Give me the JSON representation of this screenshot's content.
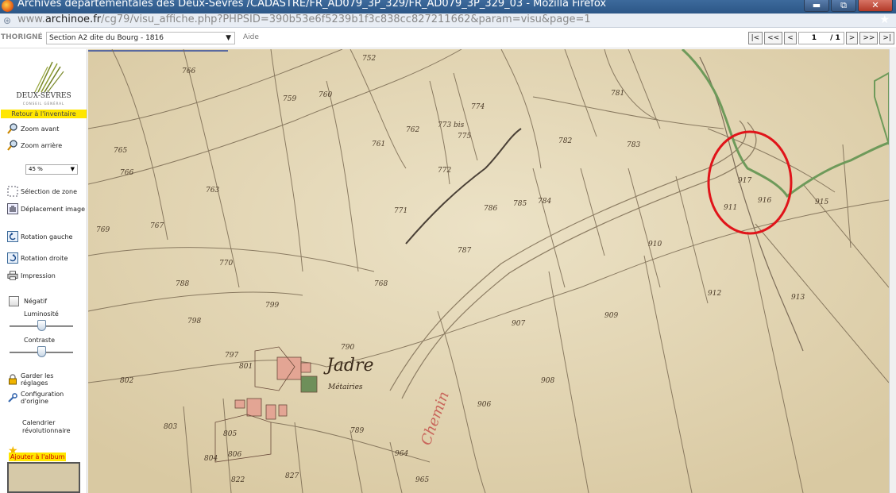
{
  "window": {
    "title": "Archives départementales des Deux-Sèvres /CADASTRE/FR_AD079_3P_329/FR_AD079_3P_329_03 - Mozilla Firefox",
    "buttons": [
      "▬",
      "⧉",
      "✕"
    ]
  },
  "address_bar": {
    "url_prefix": "www.",
    "url_domain": "archinoe.fr",
    "url_path": "/cg79/visu_affiche.php?PHPSID=390b53e6f5239b1f3c838cc827211662&param=visu&page=1"
  },
  "toolbar": {
    "commune": "THORIGNÉ",
    "section": "Section A2 dite du Bourg - 1816",
    "aide": "Aide",
    "pager": {
      "first": "|<",
      "prev_fast": "<<",
      "prev": "<",
      "current_page": "1",
      "total_pages": "/ 1",
      "next": ">",
      "next_fast": ">>",
      "last": ">|"
    }
  },
  "sidebar": {
    "logo_text": "DEUX-SÈVRES",
    "logo_sub": "CONSEIL GÉNÉRAL",
    "retour": "Retour à l'inventaire",
    "zoom_in": "Zoom avant",
    "zoom_out": "Zoom arrière",
    "zoom_level": "45 %",
    "selection_zone": "Sélection de zone",
    "deplacement": "Déplacement image",
    "rotation_gauche": "Rotation gauche",
    "rotation_droite": "Rotation droite",
    "impression": "Impression",
    "negatif": "Négatif",
    "luminosite": "Luminosité",
    "luminosite_level": 0.5,
    "contraste": "Contraste",
    "contraste_level": 0.5,
    "garder": "Garder les réglages",
    "configuration": "Configuration d'origine",
    "calendrier": "Calendrier révolutionnaire",
    "album": "Ajouter à l'album"
  },
  "map": {
    "place_name": "Jadre",
    "place_sub": "Métairies",
    "parcel_numbers": [
      "752",
      "766",
      "759",
      "760",
      "761",
      "762",
      "773 bis",
      "774",
      "775",
      "781",
      "782",
      "783",
      "765",
      "766",
      "763",
      "772",
      "767",
      "768",
      "771",
      "770",
      "786",
      "785",
      "784",
      "787",
      "788",
      "769",
      "911",
      "912",
      "913",
      "915",
      "916",
      "917",
      "908",
      "909",
      "910",
      "906",
      "907",
      "790",
      "789",
      "804",
      "805",
      "806",
      "801",
      "797",
      "798",
      "799",
      "802",
      "803",
      "822",
      "827",
      "964",
      "965"
    ],
    "highlight_circle_color": "#e0141a"
  }
}
